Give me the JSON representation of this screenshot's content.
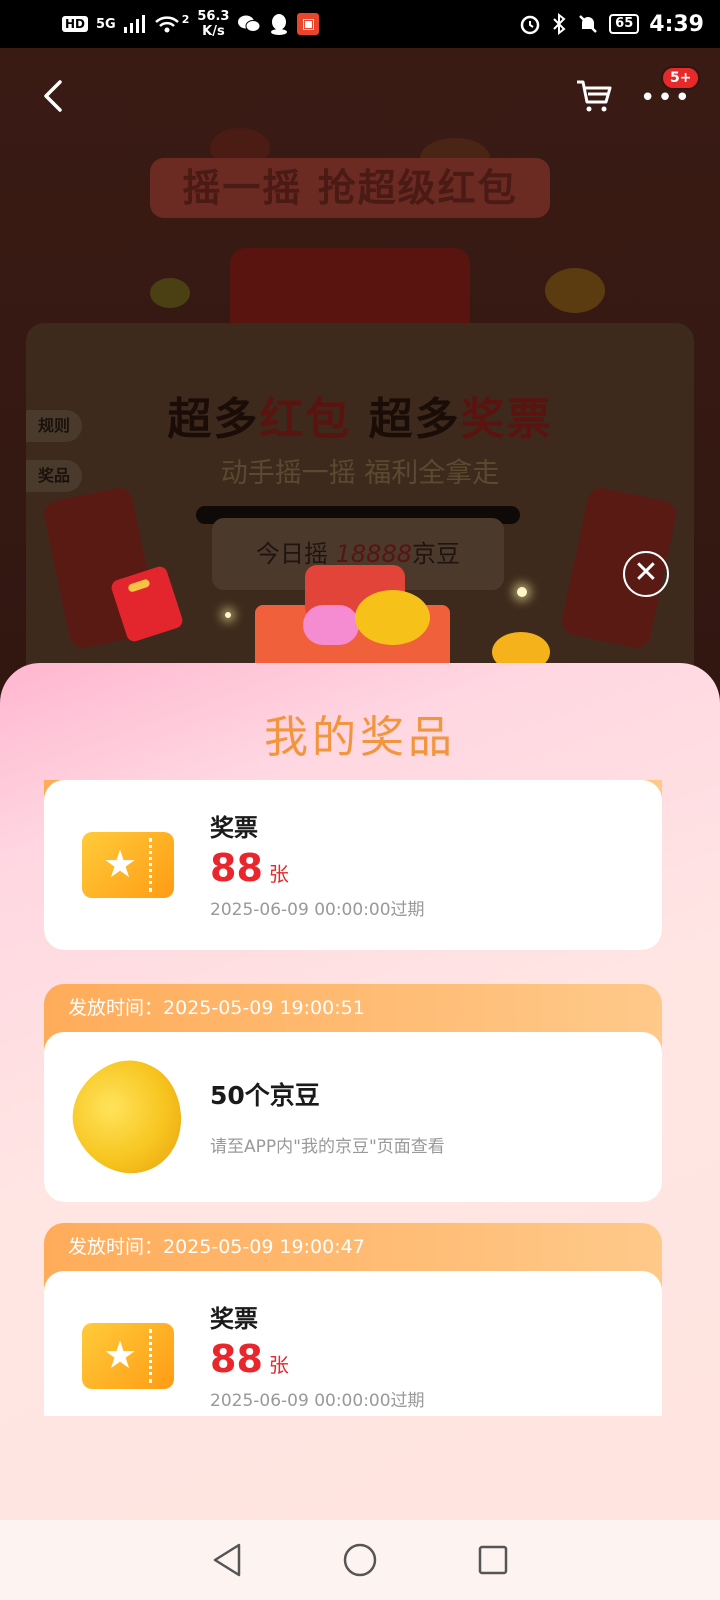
{
  "status_bar": {
    "hd": "HD",
    "signal": "5G",
    "wifi_sup": "2",
    "speed_value": "56.3",
    "speed_unit": "K/s",
    "battery": "65",
    "time": "4:39"
  },
  "top_nav": {
    "more_badge": "5+"
  },
  "hero": {
    "title": "摇一摇 抢超级红包"
  },
  "promo": {
    "title_part1": "超多",
    "title_part2": "红包",
    "title_part3": " 超多",
    "title_part4": "奖票",
    "subtitle": "动手摇一摇 福利全拿走",
    "today_prefix": "今日摇 ",
    "today_amount": "18888",
    "today_suffix": "京豆",
    "side_tabs": [
      "规则",
      "奖品"
    ]
  },
  "sheet": {
    "title": "我的奖品",
    "groups": [
      {
        "header": "",
        "prize": {
          "name": "奖票",
          "amount": "88",
          "unit": "张",
          "expiry": "2025-06-09 00:00:00过期"
        }
      },
      {
        "header": "发放时间：2025-05-09 19:00:51",
        "prize": {
          "name": "50个京豆",
          "note": "请至APP内\"我的京豆\"页面查看"
        }
      },
      {
        "header": "发放时间：2025-05-09 19:00:47",
        "prize": {
          "name": "奖票",
          "amount": "88",
          "unit": "张",
          "expiry": "2025-06-09 00:00:00过期"
        }
      }
    ]
  },
  "icons": {
    "back": "back-arrow-icon",
    "cart": "cart-icon",
    "more": "more-icon",
    "close": "close-icon",
    "ticket": "ticket-icon",
    "bean": "jingdou-bean-icon"
  },
  "colors": {
    "accent_orange": "#f2963e",
    "price_red": "#e8262b",
    "group_header": "#ffac5a"
  }
}
